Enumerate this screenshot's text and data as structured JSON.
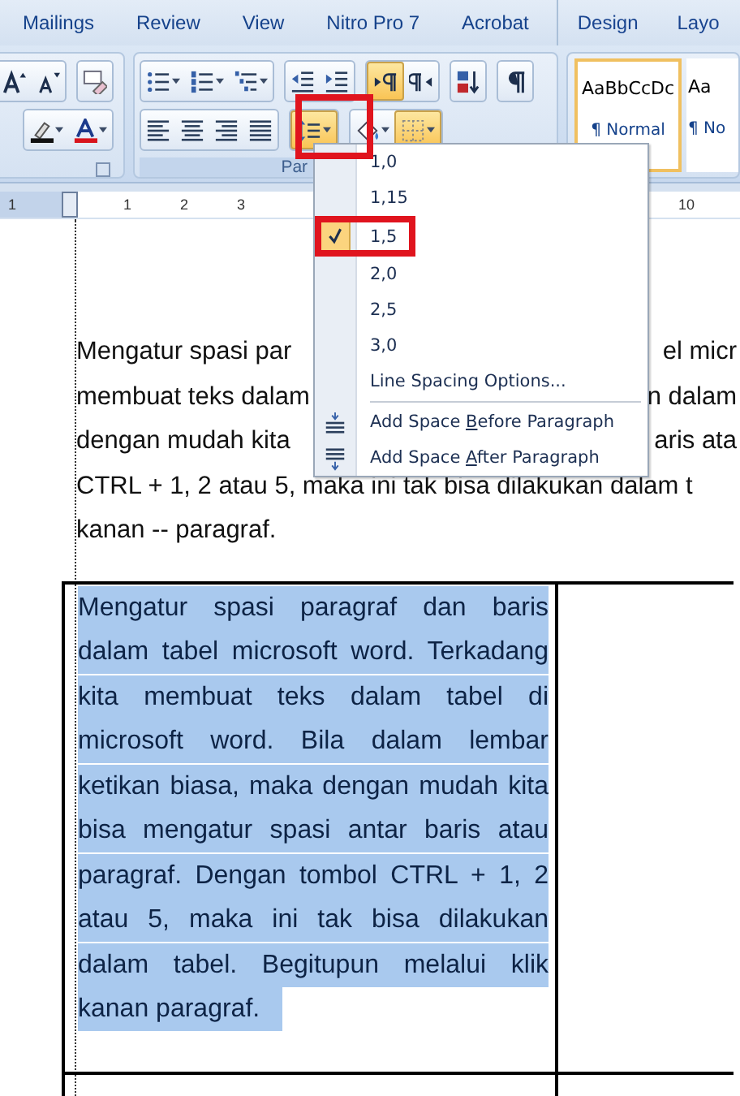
{
  "ribbon_tabs": [
    {
      "label": "Mailings",
      "selected": false,
      "contextual": false
    },
    {
      "label": "Review",
      "selected": false,
      "contextual": false
    },
    {
      "label": "View",
      "selected": false,
      "contextual": false
    },
    {
      "label": "Nitro Pro 7",
      "selected": false,
      "contextual": false
    },
    {
      "label": "Acrobat",
      "selected": false,
      "contextual": false
    },
    {
      "label": "Design",
      "selected": false,
      "contextual": true
    },
    {
      "label": "Layo",
      "selected": false,
      "contextual": true
    }
  ],
  "font_group": {
    "row_1": [
      {
        "buttons": [
          {
            "kind": "grow-font",
            "active": false,
            "dropdown": false
          },
          {
            "kind": "shrink-font",
            "active": false,
            "dropdown": false
          }
        ]
      },
      {
        "buttons": [
          {
            "kind": "clear-format",
            "active": false,
            "dropdown": false
          }
        ]
      }
    ],
    "row_2": [
      {
        "buttons": [
          {
            "kind": "highlight",
            "active": false,
            "dropdown": true
          },
          {
            "kind": "font-color",
            "active": false,
            "dropdown": true
          }
        ]
      }
    ]
  },
  "paragraph_group": {
    "label": "Par",
    "row_1": [
      {
        "buttons": [
          {
            "kind": "bullets",
            "active": false,
            "dropdown": true
          },
          {
            "kind": "numbering",
            "active": false,
            "dropdown": true
          },
          {
            "kind": "multilevel",
            "active": false,
            "dropdown": true
          }
        ]
      },
      {
        "buttons": [
          {
            "kind": "outdent",
            "active": false,
            "dropdown": false
          },
          {
            "kind": "indent",
            "active": false,
            "dropdown": false
          }
        ]
      },
      {
        "buttons": [
          {
            "kind": "ltr",
            "active": true,
            "dropdown": false
          },
          {
            "kind": "rtl",
            "active": false,
            "dropdown": false
          }
        ]
      },
      {
        "buttons": [
          {
            "kind": "sort",
            "active": false,
            "dropdown": false
          }
        ]
      },
      {
        "buttons": [
          {
            "kind": "pilcrow",
            "active": false,
            "dropdown": false
          }
        ]
      }
    ],
    "row_2": [
      {
        "buttons": [
          {
            "kind": "align-left",
            "active": false,
            "dropdown": false
          },
          {
            "kind": "align-center",
            "active": false,
            "dropdown": false
          },
          {
            "kind": "align-right",
            "active": false,
            "dropdown": false
          },
          {
            "kind": "justify",
            "active": false,
            "dropdown": false
          }
        ]
      },
      {
        "buttons": [
          {
            "kind": "line-spacing",
            "active": true,
            "dropdown": true,
            "highlighted": true
          }
        ]
      },
      {
        "buttons": [
          {
            "kind": "shading",
            "active": false,
            "dropdown": true
          },
          {
            "kind": "borders",
            "active": true,
            "dropdown": true
          }
        ]
      }
    ]
  },
  "styles": [
    {
      "sample": "AaBbCcDc",
      "name": "¶ Normal",
      "selected": true
    },
    {
      "sample": "Aa",
      "name": "¶ No",
      "selected": false
    }
  ],
  "ruler": {
    "left_labels": [
      "1",
      "1",
      "2",
      "3"
    ],
    "right_labels": [
      "10"
    ]
  },
  "line_spacing_menu": {
    "options": [
      {
        "label": "1,0",
        "selected": false,
        "highlighted": false
      },
      {
        "label": "1,15",
        "selected": false,
        "highlighted": false
      },
      {
        "label": "1,5",
        "selected": true,
        "highlighted": true
      },
      {
        "label": "2,0",
        "selected": false,
        "highlighted": false
      },
      {
        "label": "2,5",
        "selected": false,
        "highlighted": false
      },
      {
        "label": "3,0",
        "selected": false,
        "highlighted": false
      }
    ],
    "more": "Line Spacing Options...",
    "actions": [
      {
        "kind": "space-before",
        "label_parts": [
          "Add Space ",
          "B",
          "efore Paragraph"
        ]
      },
      {
        "kind": "space-after",
        "label_parts": [
          "Add Space ",
          "A",
          "fter Paragraph"
        ]
      }
    ]
  },
  "document": {
    "paragraph_lines": [
      {
        "left": "Mengatur spasi par",
        "right": "el micr"
      },
      {
        "left": "membuat teks dalam",
        "right": "n dalam"
      },
      {
        "left": "dengan mudah kita",
        "right": "aris ata"
      },
      {
        "left": "CTRL + 1, 2 atau 5, maka ini tak bisa dilakukan dalam t"
      },
      {
        "left": "kanan -- paragraf."
      }
    ],
    "table": {
      "cell_text": "Mengatur spasi paragraf dan baris dalam tabel microsoft word. Terkadang kita membuat teks dalam tabel di microsoft word. Bila dalam lembar ketikan biasa, maka dengan mudah kita bisa mengatur spasi antar baris atau paragraf. Dengan tombol CTRL + 1, 2 atau 5, maka ini tak bisa dilakukan dalam tabel. Begitupun melalui klik kanan paragraf.",
      "selected": true
    }
  }
}
